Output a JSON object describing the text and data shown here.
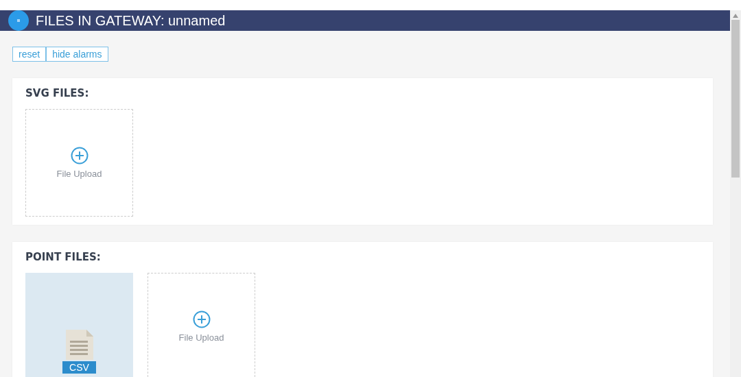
{
  "header": {
    "title": "FILES IN GATEWAY: unnamed"
  },
  "toolbar": [
    "reset",
    "hide alarms"
  ],
  "sections": [
    {
      "title": "SVG FILES:",
      "tiles": [
        {
          "kind": "upload",
          "label": "File Upload"
        }
      ]
    },
    {
      "title": "POINT FILES:",
      "tiles": [
        {
          "kind": "file",
          "label": "CSV"
        },
        {
          "kind": "upload",
          "label": "File Upload"
        }
      ]
    }
  ]
}
